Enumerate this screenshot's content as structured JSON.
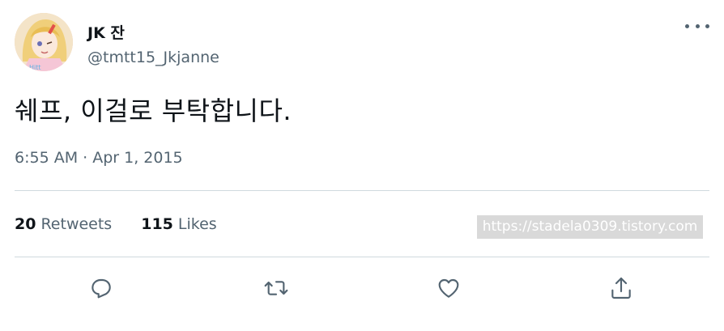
{
  "tweet": {
    "display_name": "JK 잔",
    "handle": "@tmtt15_Jkjanne",
    "text": "쉐프, 이걸로 부탁합니다.",
    "timestamp": "6:55 AM · Apr 1, 2015",
    "stats": {
      "retweets_count": "20",
      "retweets_label": "Retweets",
      "likes_count": "115",
      "likes_label": "Likes"
    },
    "watermark": "https://stadela0309.tistory.com",
    "icons": {
      "more": "more-options-icon",
      "reply": "reply-icon",
      "retweet": "retweet-icon",
      "like": "heart-icon",
      "share": "share-icon"
    },
    "colors": {
      "text_primary": "#0f1419",
      "text_secondary": "#536471",
      "divider": "#cfd9de"
    }
  }
}
